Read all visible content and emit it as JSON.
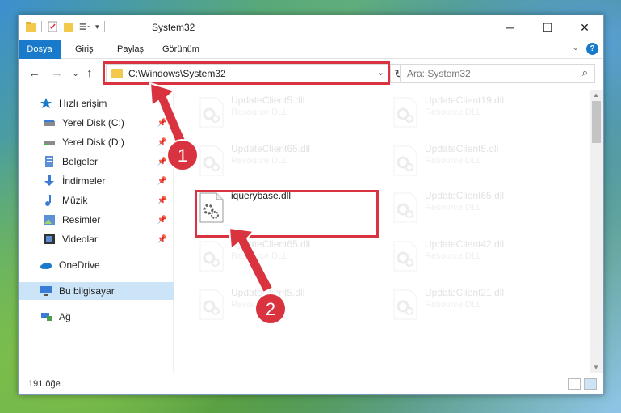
{
  "window": {
    "title": "System32",
    "controls": [
      "─",
      "☐",
      "✕"
    ]
  },
  "ribbon": {
    "tabs": [
      "Dosya",
      "Giriş",
      "Paylaş",
      "Görünüm"
    ],
    "collapse_icon": "chevron-down-icon",
    "help_label": "?"
  },
  "navigation": {
    "back": "←",
    "forward": "→",
    "recent": "⌄",
    "up": "↑",
    "address_path": "C:\\Windows\\System32",
    "refresh": "↻",
    "search_placeholder": "Ara: System32",
    "search_icon": "⌕"
  },
  "sidebar": {
    "items": [
      {
        "label": "Hızlı erişim",
        "icon": "star-icon",
        "pinned": false
      },
      {
        "label": "Yerel Disk (C:)",
        "icon": "drive-icon",
        "pinned": true
      },
      {
        "label": "Yerel Disk (D:)",
        "icon": "drive-icon",
        "pinned": true
      },
      {
        "label": "Belgeler",
        "icon": "documents-icon",
        "pinned": true
      },
      {
        "label": "İndirmeler",
        "icon": "download-icon",
        "pinned": true
      },
      {
        "label": "Müzik",
        "icon": "music-icon",
        "pinned": true
      },
      {
        "label": "Resimler",
        "icon": "pictures-icon",
        "pinned": true
      },
      {
        "label": "Videolar",
        "icon": "videos-icon",
        "pinned": true
      },
      {
        "label": "OneDrive",
        "icon": "cloud-icon",
        "pinned": false
      },
      {
        "label": "Bu bilgisayar",
        "icon": "computer-icon",
        "pinned": false,
        "selected": true
      },
      {
        "label": "Ağ",
        "icon": "network-icon",
        "pinned": false
      }
    ]
  },
  "files": [
    {
      "name": "UpdateClient5.dll",
      "type": "Resource DLL",
      "faded": true
    },
    {
      "name": "UpdateClient19.dll",
      "type": "Resource DLL",
      "faded": true
    },
    {
      "name": "UpdateClient65.dll",
      "type": "Resource DLL",
      "faded": true
    },
    {
      "name": "UpdateClient5.dll",
      "type": "Resource DLL",
      "faded": true
    },
    {
      "name": "iquerybase.dll",
      "type": "",
      "faded": false,
      "highlighted": true
    },
    {
      "name": "UpdateClient65.dll",
      "type": "Resource DLL",
      "faded": true
    },
    {
      "name": "UpdateClient65.dll",
      "type": "Resource DLL",
      "faded": true
    },
    {
      "name": "UpdateClient42.dll",
      "type": "Resource DLL",
      "faded": true
    },
    {
      "name": "UpdateClient5.dll",
      "type": "Resource DLL",
      "faded": true
    },
    {
      "name": "UpdateClient21.dll",
      "type": "Resource DLL",
      "faded": true
    }
  ],
  "status": {
    "item_count": "191 öğe"
  },
  "annotations": {
    "step1": "1",
    "step2": "2",
    "color": "#d9333f"
  },
  "colors": {
    "accent": "#1979ca",
    "selection": "#cce4f7",
    "highlight_box": "#d9333f"
  }
}
